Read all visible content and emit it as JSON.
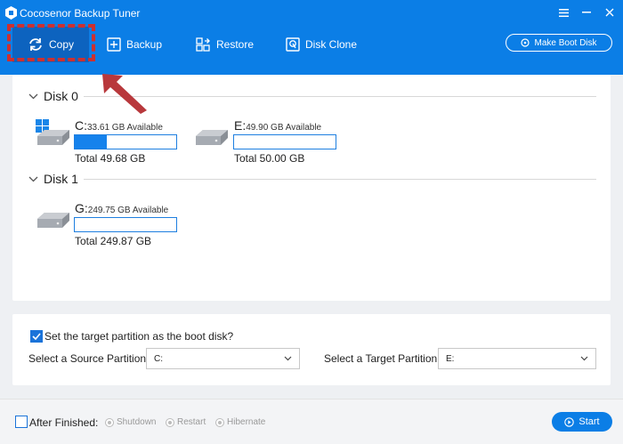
{
  "window": {
    "title": "Cocosenor Backup Tuner"
  },
  "toolbar": {
    "copy_label": "Copy",
    "backup_label": "Backup",
    "restore_label": "Restore",
    "clone_label": "Disk Clone",
    "boot_label": "Make Boot Disk"
  },
  "disks": [
    {
      "label": "Disk 0",
      "partitions": [
        {
          "letter": "C:",
          "available": "33.61 GB Available",
          "total": "Total 49.68 GB",
          "used_fraction": 0.32,
          "system": true
        },
        {
          "letter": "E:",
          "available": "49.90 GB Available",
          "total": "Total 50.00 GB",
          "used_fraction": 0.0,
          "system": false
        }
      ]
    },
    {
      "label": "Disk 1",
      "partitions": [
        {
          "letter": "G:",
          "available": "249.75 GB Available",
          "total": "Total 249.87 GB",
          "used_fraction": 0.0,
          "system": false
        }
      ]
    }
  ],
  "options": {
    "boot_checkbox_label": "Set the target partition as the boot disk?",
    "boot_checked": true,
    "source_label": "Select a Source Partition:",
    "source_value": "C:",
    "target_label": "Select a Target Partition:",
    "target_value": "E:"
  },
  "footer": {
    "after_label": "After Finished:",
    "after_checked": false,
    "radios": [
      "Shutdown",
      "Restart",
      "Hibernate"
    ],
    "start_label": "Start"
  },
  "colors": {
    "brand": "#0b7ee6",
    "active_tab": "#0d63bf",
    "annotation": "#cc3030"
  }
}
